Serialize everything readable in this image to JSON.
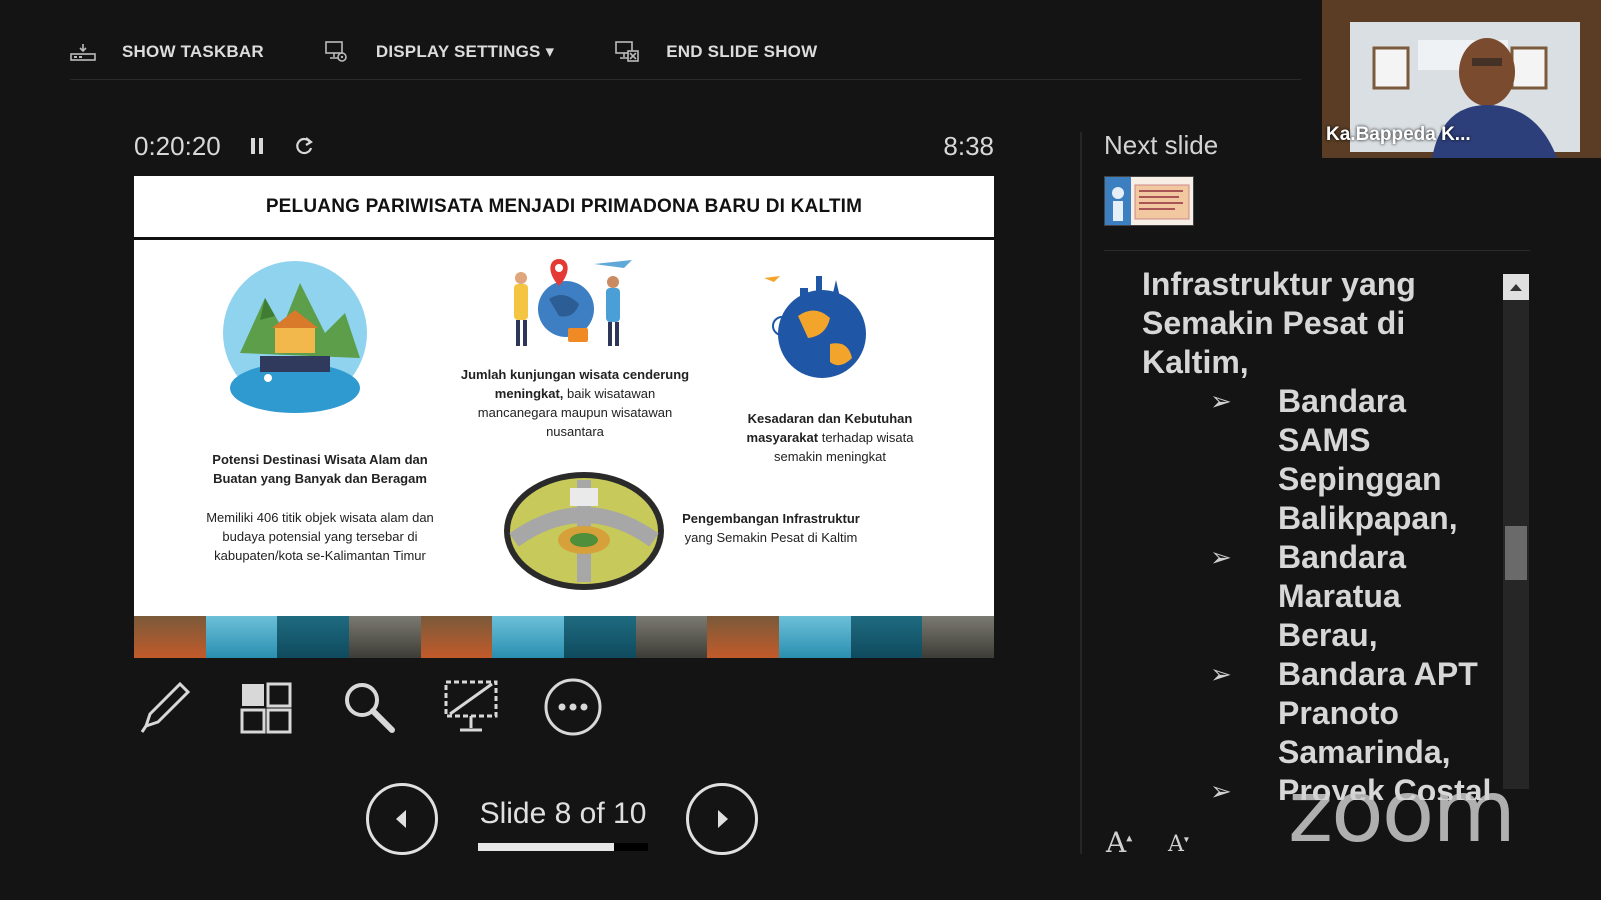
{
  "toolbar": {
    "show_taskbar": "SHOW TASKBAR",
    "display_settings": "DISPLAY SETTINGS ▾",
    "end_slide_show": "END SLIDE SHOW"
  },
  "timer": {
    "elapsed": "0:20:20",
    "clock": "8:38"
  },
  "slide": {
    "title": "PELUANG PARIWISATA MENJADI PRIMADONA BARU DI KALTIM",
    "block1_bold": "Potensi Destinasi Wisata Alam dan Buatan yang Banyak dan Beragam",
    "block1_text": "Memiliki 406 titik objek wisata alam dan budaya potensial yang tersebar di kabupaten/kota se-Kalimantan Timur",
    "block2_bold": "Jumlah kunjungan wisata cenderung meningkat,",
    "block2_text": "baik wisatawan mancanegara maupun wisatawan nusantara",
    "block3_bold": "Kesadaran dan Kebutuhan masyarakat",
    "block3_text": "terhadap wisata semakin meningkat",
    "block4_bold": "Pengembangan Infrastruktur",
    "block4_text": "yang Semakin Pesat di Kaltim"
  },
  "navigation": {
    "counter": "Slide 8 of 10",
    "current": 8,
    "total": 10
  },
  "next_panel": {
    "label": "Next slide"
  },
  "notes": {
    "intro": "Infrastruktur yang Semakin Pesat di Kaltim,",
    "bullets": [
      "Bandara SAMS Sepinggan Balikpapan,",
      "Bandara Maratua Berau,",
      "Bandara APT Pranoto Samarinda,",
      "Proyek Costal"
    ],
    "arrow": "➢"
  },
  "font_controls": {
    "increase": "A",
    "decrease": "A"
  },
  "watermark": "zoom",
  "webcam": {
    "name": "Ka.Bappeda K..."
  }
}
